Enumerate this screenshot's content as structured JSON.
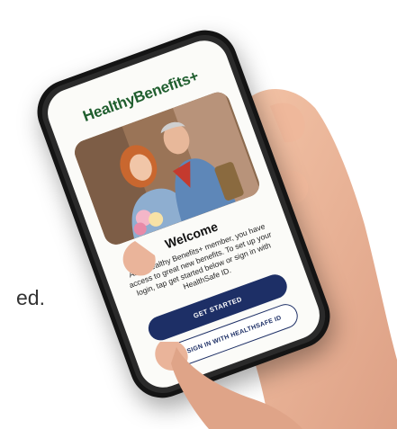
{
  "background": {
    "partial_text": "ed."
  },
  "app": {
    "logo": "HealthyBenefits+",
    "welcome_title": "Welcome",
    "welcome_body": "As a Healthy Benefits+ member, you have access to great new benefits. To set up your login, tap get started below or sign in with HealthSafe ID.",
    "get_started_label": "GET STARTED",
    "sign_in_label": "SIGN IN WITH HEALTHSAFE ID",
    "sign_in_icon": "healthsafe-id-icon"
  },
  "colors": {
    "brand_green": "#1f5e2e",
    "button_navy": "#1d2f66",
    "screen_bg": "#fbfbf8"
  }
}
